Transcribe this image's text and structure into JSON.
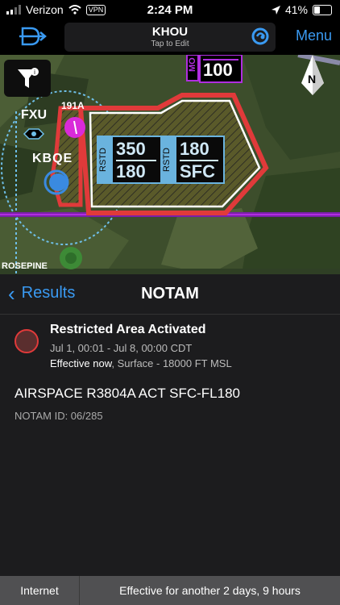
{
  "status": {
    "carrier": "Verizon",
    "vpn": "VPN",
    "time": "2:24 PM",
    "battery": "41%",
    "battery_level": 0.41
  },
  "nav": {
    "airport": "KHOU",
    "hint": "Tap to Edit",
    "menu": "Menu"
  },
  "map": {
    "labels": {
      "fxu": "FXU",
      "kbqe": "KBQE",
      "tr_label": "191A",
      "rosepine": "ROSEPINE",
      "north": "N",
      "mo": "MO",
      "mo_alt": "100"
    },
    "blocks": [
      {
        "tag": "RSTD",
        "top": "350",
        "bottom": "180"
      },
      {
        "tag": "RSTD",
        "top": "180",
        "bottom": "SFC"
      }
    ]
  },
  "panel": {
    "back": "Results",
    "title": "NOTAM",
    "notam": {
      "title": "Restricted Area Activated",
      "dates": "Jul 1, 00:01 - Jul 8, 00:00 CDT",
      "effective_now": "Effective now",
      "effective_rest": ", Surface - 18000 FT MSL",
      "text": "AIRSPACE R3804A ACT SFC-FL180",
      "id": "NOTAM ID: 06/285"
    }
  },
  "bottom": {
    "left": "Internet",
    "right": "Effective for another 2 days, 9 hours"
  },
  "colors": {
    "accent": "#3a9af2",
    "restricted": "#e03a3a",
    "purple": "#b02de0"
  }
}
